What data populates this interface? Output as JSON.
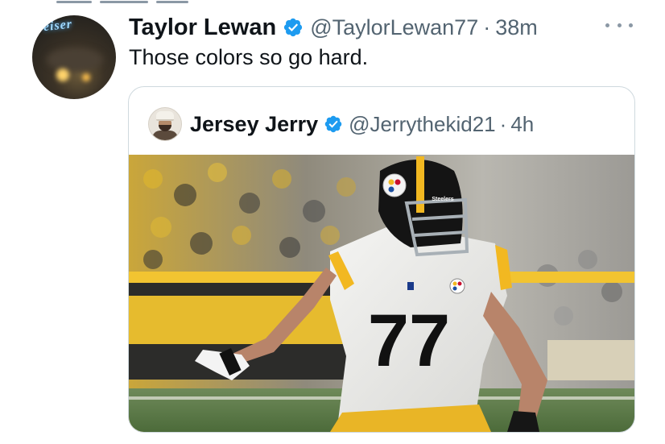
{
  "tweet": {
    "author": {
      "display_name": "Taylor Lewan",
      "handle": "@TaylorLewan77",
      "separator": "·",
      "time": "38m",
      "avatar_sign_text": "eiser"
    },
    "text": "Those colors so go hard."
  },
  "quoted_tweet": {
    "author": {
      "display_name": "Jersey Jerry",
      "handle": "@Jerrythekid21",
      "separator": "·",
      "time": "4h"
    },
    "image": {
      "jersey_number": "77",
      "helmet_text": "Steelers"
    }
  },
  "colors": {
    "verified_blue": "#1d9bf0",
    "secondary_text": "#536471",
    "border": "#cfd9de",
    "steelers_gold": "#f2b821"
  },
  "icons": {
    "verified": "verified-badge-icon",
    "more": "more-options-icon"
  }
}
